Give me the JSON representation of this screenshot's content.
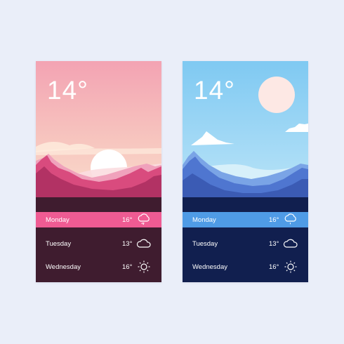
{
  "colors": {
    "page_background": "#eaeef9",
    "pink_accent": "#ef5b93",
    "pink_panel": "#3f1c2f",
    "blue_accent": "#4f9be6",
    "blue_panel": "#111f4f"
  },
  "cards": [
    {
      "theme": "sunset",
      "temperature": "14°",
      "forecast": [
        {
          "day": "Monday",
          "temp": "16°",
          "icon": "cloud-rain-icon"
        },
        {
          "day": "Tuesday",
          "temp": "13°",
          "icon": "cloud-icon"
        },
        {
          "day": "Wednesday",
          "temp": "16°",
          "icon": "sun-icon"
        }
      ]
    },
    {
      "theme": "daytime",
      "temperature": "14°",
      "forecast": [
        {
          "day": "Monday",
          "temp": "16°",
          "icon": "cloud-rain-icon"
        },
        {
          "day": "Tuesday",
          "temp": "13°",
          "icon": "cloud-icon"
        },
        {
          "day": "Wednesday",
          "temp": "16°",
          "icon": "sun-icon"
        }
      ]
    }
  ]
}
